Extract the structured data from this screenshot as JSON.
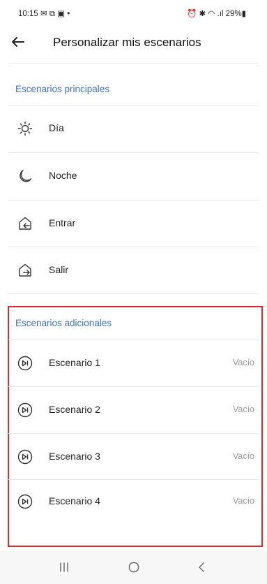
{
  "status_bar": {
    "time_icons": "10:15 ✉ ⧉ ▣ •",
    "system": "⏰ ✱ ◠ .ıl 29%▮"
  },
  "appbar": {
    "title": "Personalizar mis escenarios",
    "back_icon": "arrow-left-icon"
  },
  "main_section": {
    "title": "Escenarios principales",
    "items": [
      {
        "label": "Día",
        "icon": "sun-icon"
      },
      {
        "label": "Noche",
        "icon": "moon-icon"
      },
      {
        "label": "Entrar",
        "icon": "home-enter-icon"
      },
      {
        "label": "Salir",
        "icon": "home-exit-icon"
      }
    ]
  },
  "extra_section": {
    "title": "Escenarios adicionales",
    "items": [
      {
        "label": "Escenario 1",
        "value": "Vacío",
        "icon": "play-pause-icon"
      },
      {
        "label": "Escenario 2",
        "value": "Vacío",
        "icon": "play-pause-icon"
      },
      {
        "label": "Escenario 3",
        "value": "Vacío",
        "icon": "play-pause-icon"
      },
      {
        "label": "Escenario 4",
        "value": "Vacío",
        "icon": "play-pause-icon"
      }
    ]
  },
  "colors": {
    "accent": "#3b73c8",
    "highlight_border": "#e02a2a"
  },
  "navbar": {
    "recents_icon": "recents-icon",
    "home_icon": "home-icon",
    "back_icon": "back-icon"
  }
}
